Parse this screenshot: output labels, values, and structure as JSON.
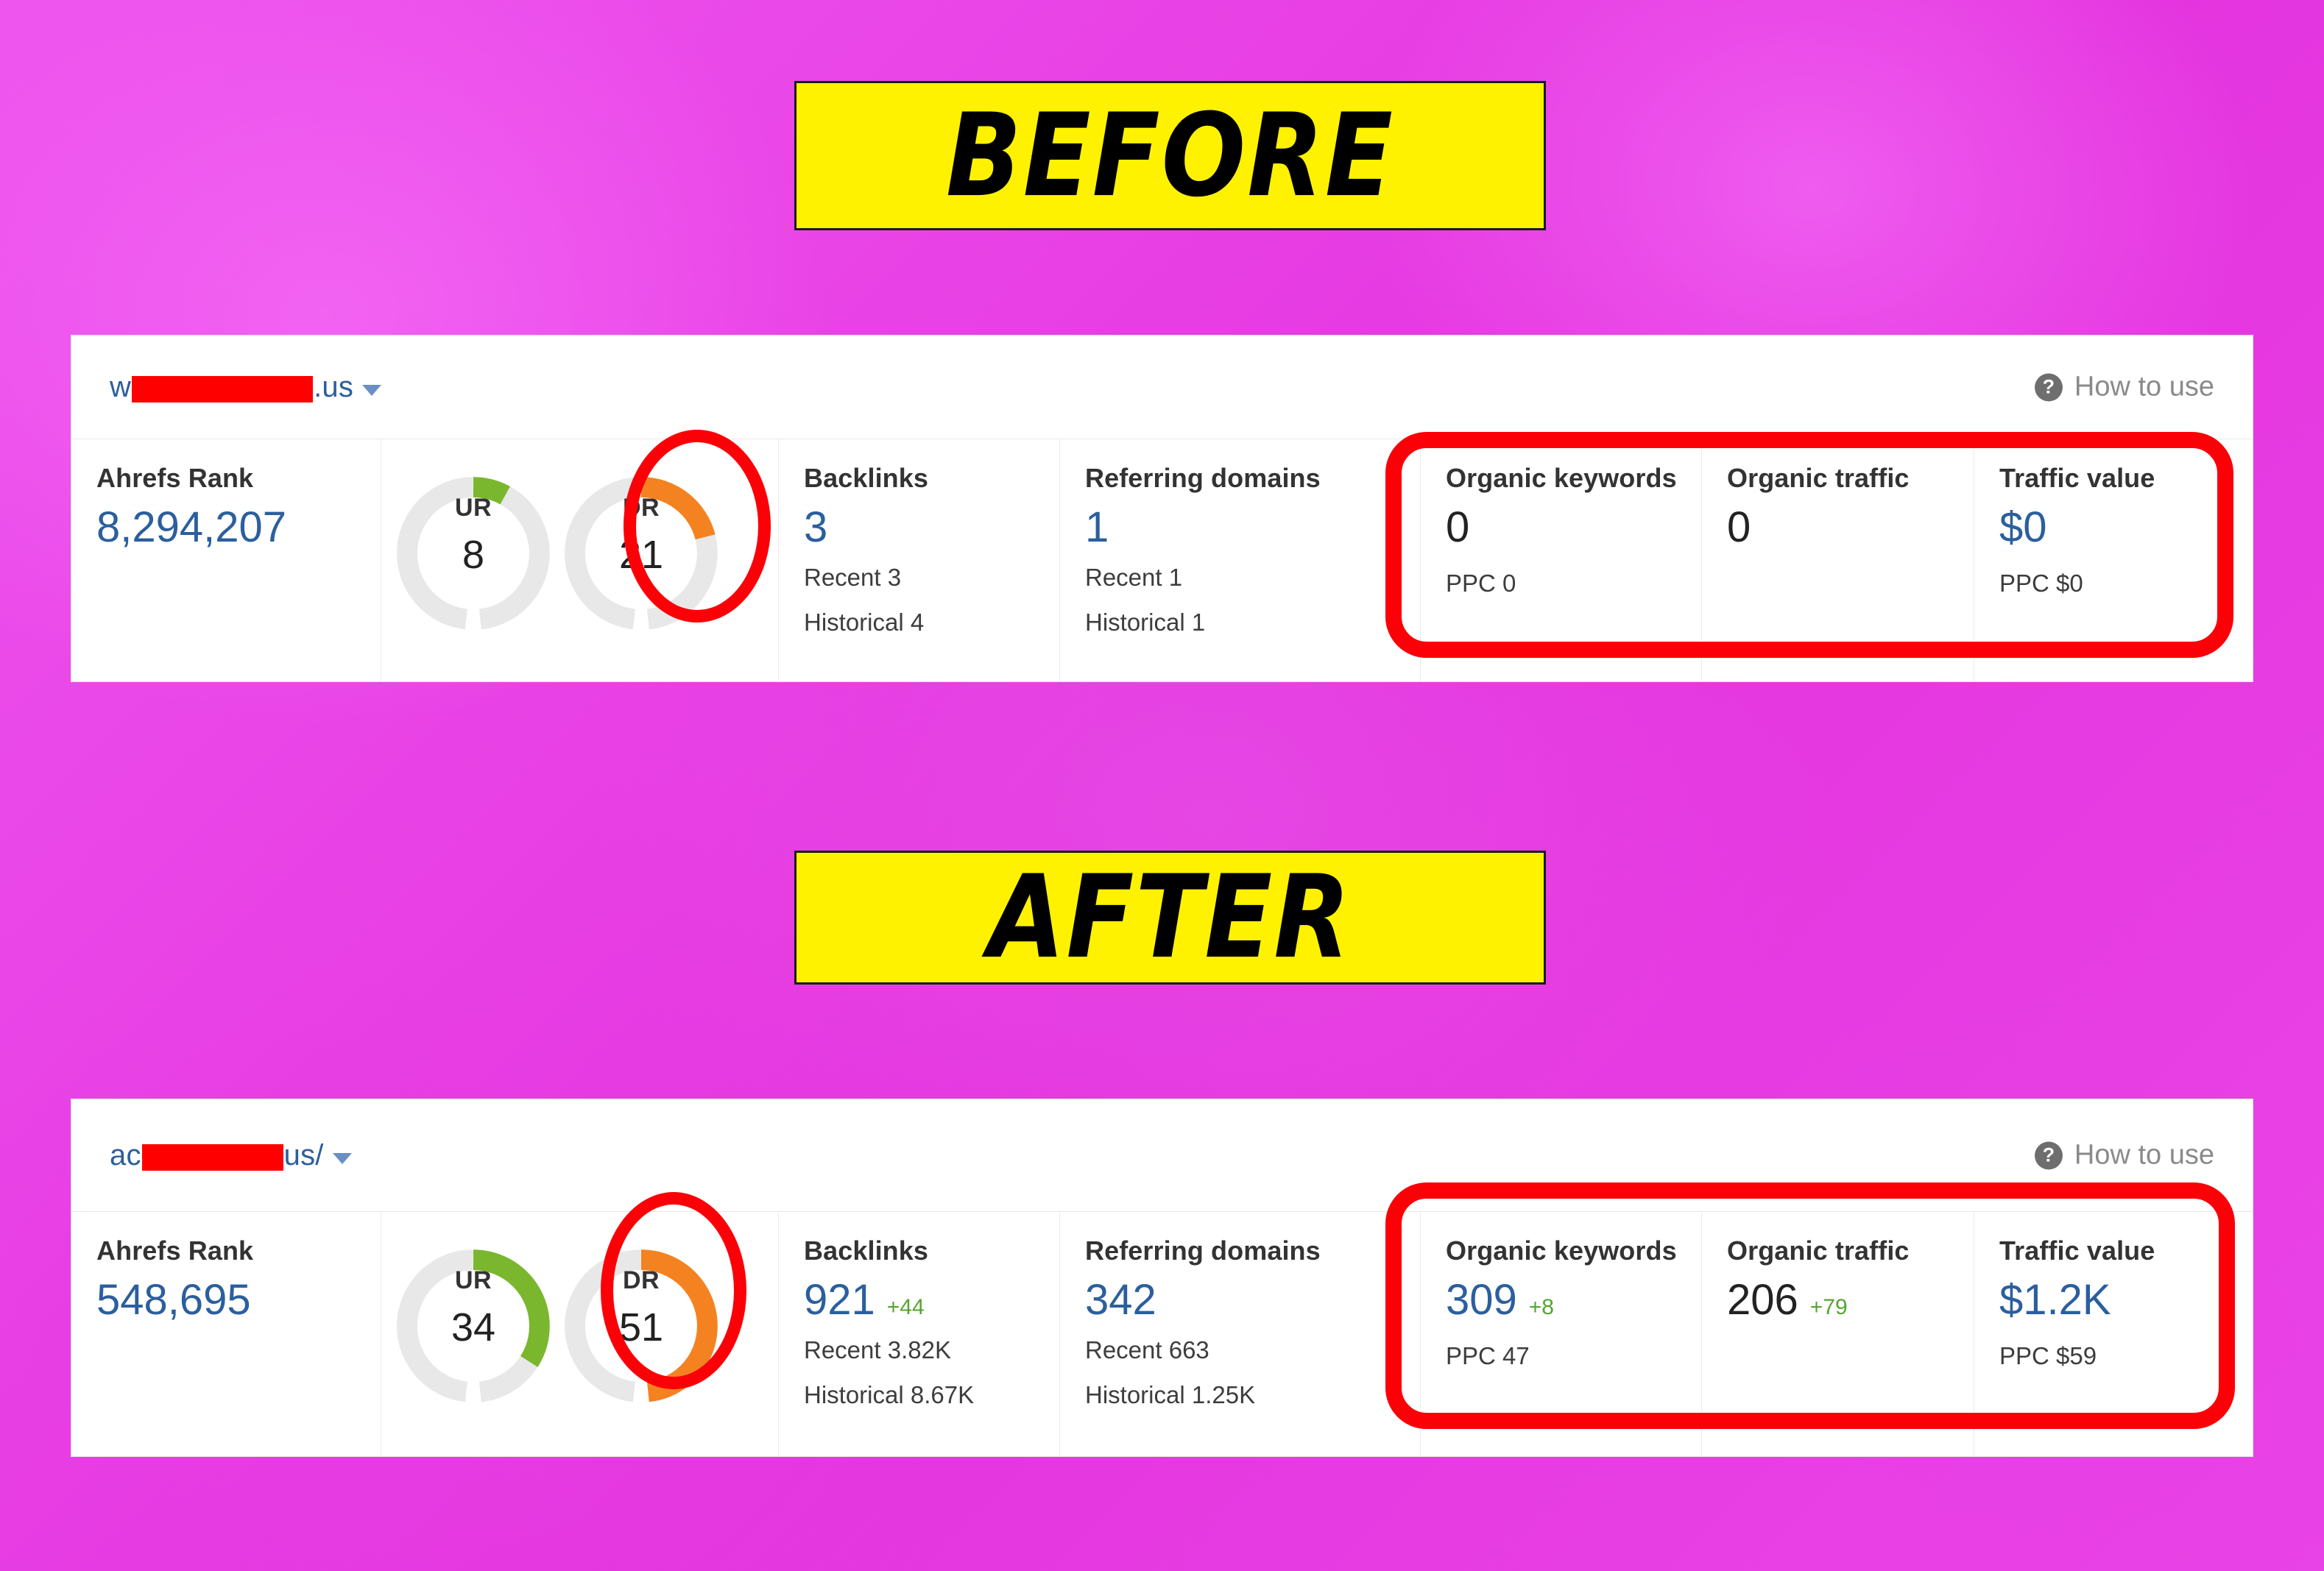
{
  "banners": {
    "before": "BEFORE",
    "after": "AFTER"
  },
  "panels": [
    {
      "id": "before",
      "header": {
        "domain_prefix": "w",
        "domain_suffix": ".us",
        "redacted": true,
        "dropdown_icon": "chevron-down-icon",
        "help_icon": "question-mark-icon",
        "help_label": "How to use"
      },
      "metrics": {
        "ahrefs_rank": {
          "label": "Ahrefs Rank",
          "value": "8,294,207"
        },
        "ur": {
          "label": "UR",
          "value": "8",
          "percent": 8,
          "color": "#7ab72e"
        },
        "dr": {
          "label": "DR",
          "value": "21",
          "percent": 21,
          "color": "#f58220"
        },
        "backlinks": {
          "label": "Backlinks",
          "value": "3",
          "delta": "",
          "recent": "Recent 3",
          "historical": "Historical 4"
        },
        "referring_domains": {
          "label": "Referring domains",
          "value": "1",
          "delta": "",
          "recent": "Recent 1",
          "historical": "Historical 1"
        },
        "organic_keywords": {
          "label": "Organic keywords",
          "value": "0",
          "delta": "",
          "ppc": "PPC 0"
        },
        "organic_traffic": {
          "label": "Organic traffic",
          "value": "0",
          "delta": "",
          "ppc": ""
        },
        "traffic_value": {
          "label": "Traffic value",
          "value": "$0",
          "delta": "",
          "ppc": "PPC $0"
        }
      }
    },
    {
      "id": "after",
      "header": {
        "domain_prefix": "ac",
        "domain_suffix": "us/",
        "redacted": true,
        "dropdown_icon": "chevron-down-icon",
        "help_icon": "question-mark-icon",
        "help_label": "How to use"
      },
      "metrics": {
        "ahrefs_rank": {
          "label": "Ahrefs Rank",
          "value": "548,695"
        },
        "ur": {
          "label": "UR",
          "value": "34",
          "percent": 34,
          "color": "#7ab72e"
        },
        "dr": {
          "label": "DR",
          "value": "51",
          "percent": 51,
          "color": "#f58220"
        },
        "backlinks": {
          "label": "Backlinks",
          "value": "921",
          "delta": "+44",
          "recent": "Recent 3.82K",
          "historical": "Historical 8.67K"
        },
        "referring_domains": {
          "label": "Referring domains",
          "value": "342",
          "delta": "",
          "recent": "Recent 663",
          "historical": "Historical 1.25K"
        },
        "organic_keywords": {
          "label": "Organic keywords",
          "value": "309",
          "delta": "+8",
          "ppc": "PPC 47"
        },
        "organic_traffic": {
          "label": "Organic traffic",
          "value": "206",
          "delta": "+79",
          "ppc": ""
        },
        "traffic_value": {
          "label": "Traffic value",
          "value": "$1.2K",
          "delta": "",
          "ppc": "PPC $59"
        }
      }
    }
  ],
  "annotations": {
    "color": "#fb0007",
    "dr_circle_before": "dr-gauge-highlight",
    "dr_circle_after": "dr-gauge-highlight",
    "organic_box_before": "organic-metrics-highlight",
    "organic_box_after": "organic-metrics-highlight"
  },
  "colors": {
    "background_magenta": "#e434df",
    "banner_yellow": "#fff200",
    "link_blue": "#2b5f9e",
    "delta_green": "#55a532",
    "gauge_green": "#7ab72e",
    "gauge_orange": "#f58220",
    "annotation_red": "#fb0007",
    "redaction_red": "#ff0000"
  }
}
